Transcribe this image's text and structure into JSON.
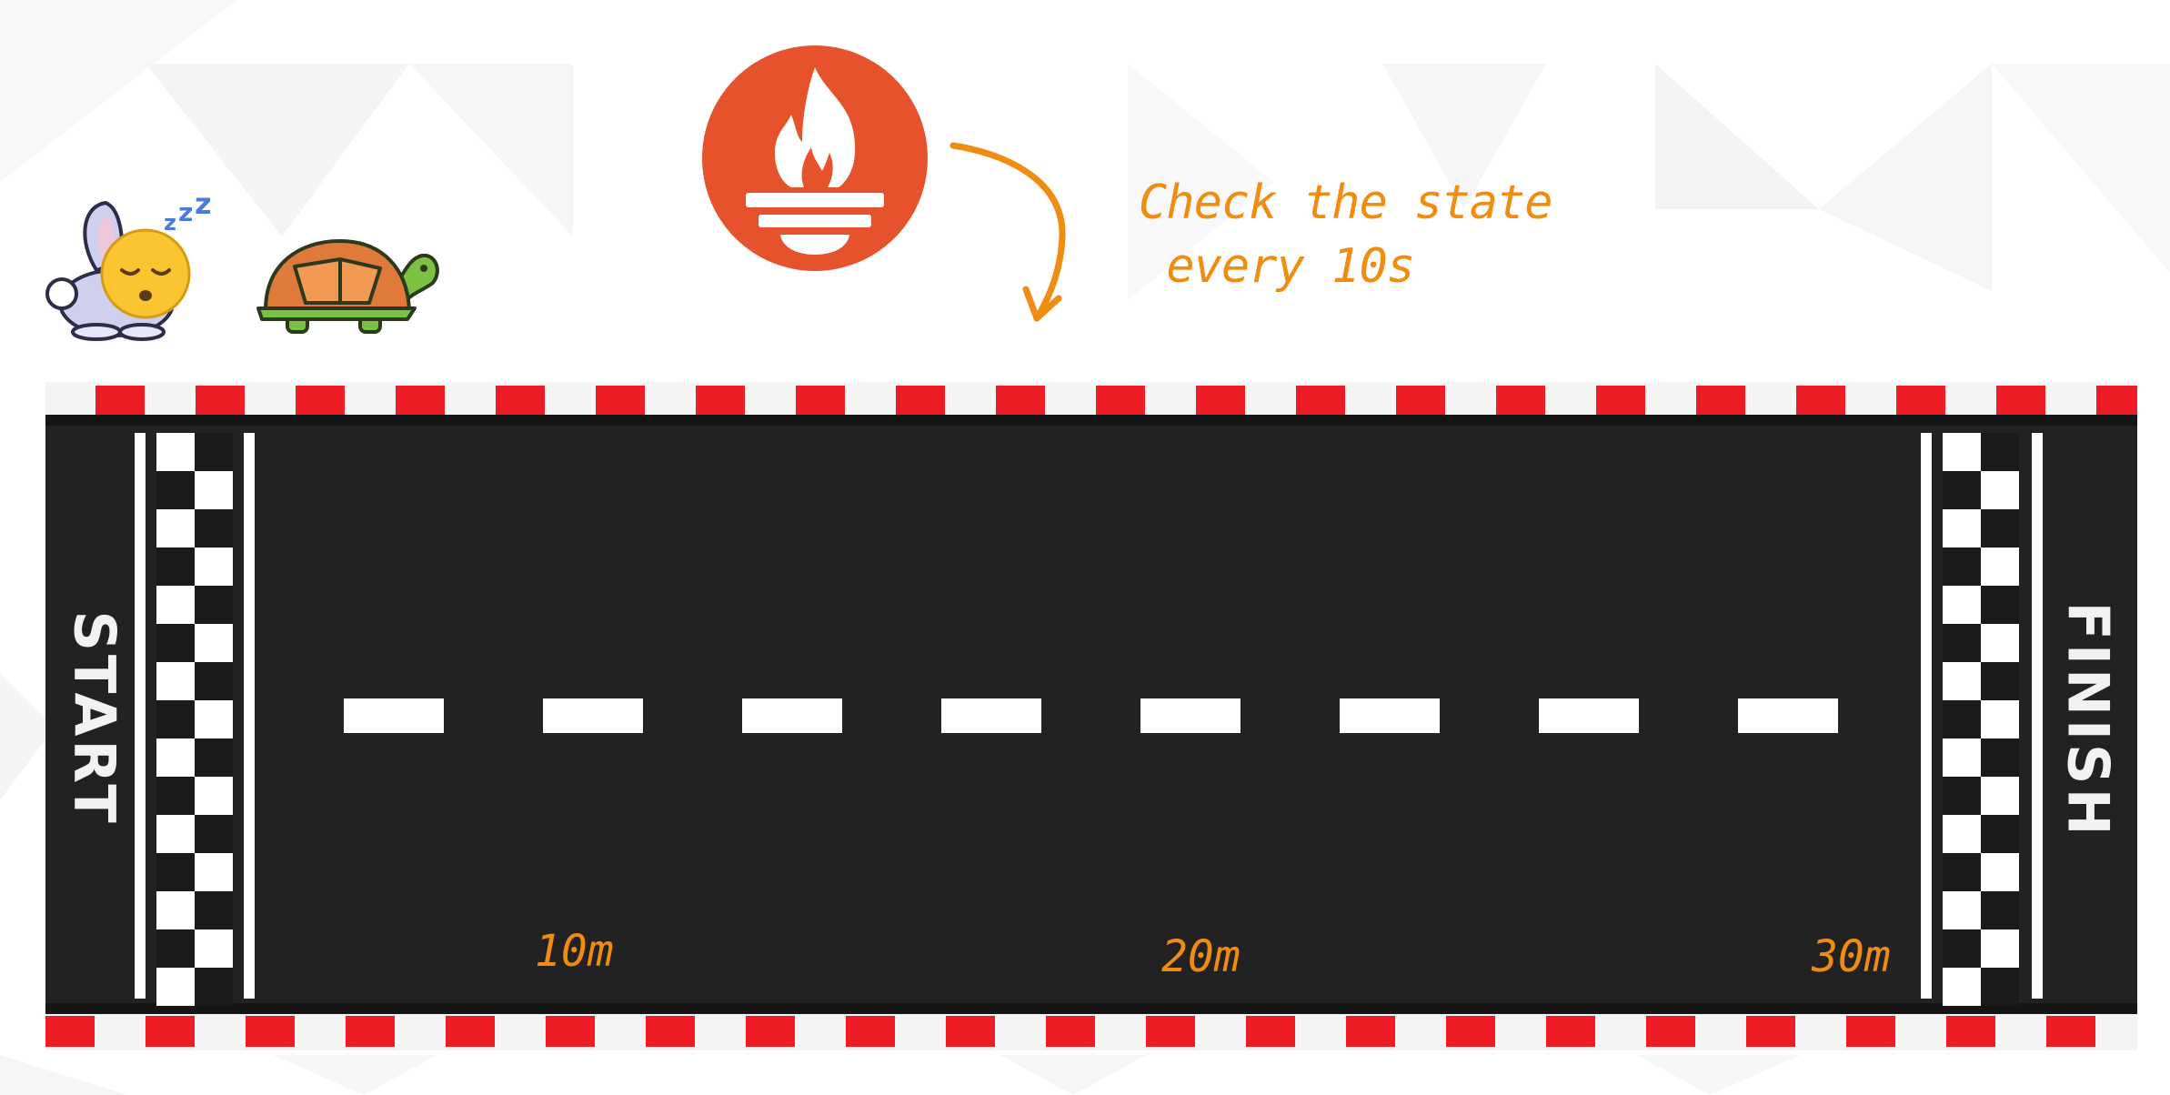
{
  "annotation": {
    "line1": "Check the state",
    "line2": " every 10s"
  },
  "track": {
    "start_label": "START",
    "finish_label": "FINISH",
    "markers": [
      "10m",
      "20m",
      "30m"
    ]
  },
  "icons": {
    "logo": "prometheus-torch-icon",
    "hare": "sleeping-rabbit-icon",
    "tortoise": "turtle-icon",
    "arrow": "curved-arrow-icon"
  },
  "colors": {
    "logo_orange": "#e6522c",
    "annotation_orange": "#f08c10",
    "track_asphalt": "#222222",
    "curb_red": "#ee1c24",
    "line_white": "#ffffff"
  }
}
